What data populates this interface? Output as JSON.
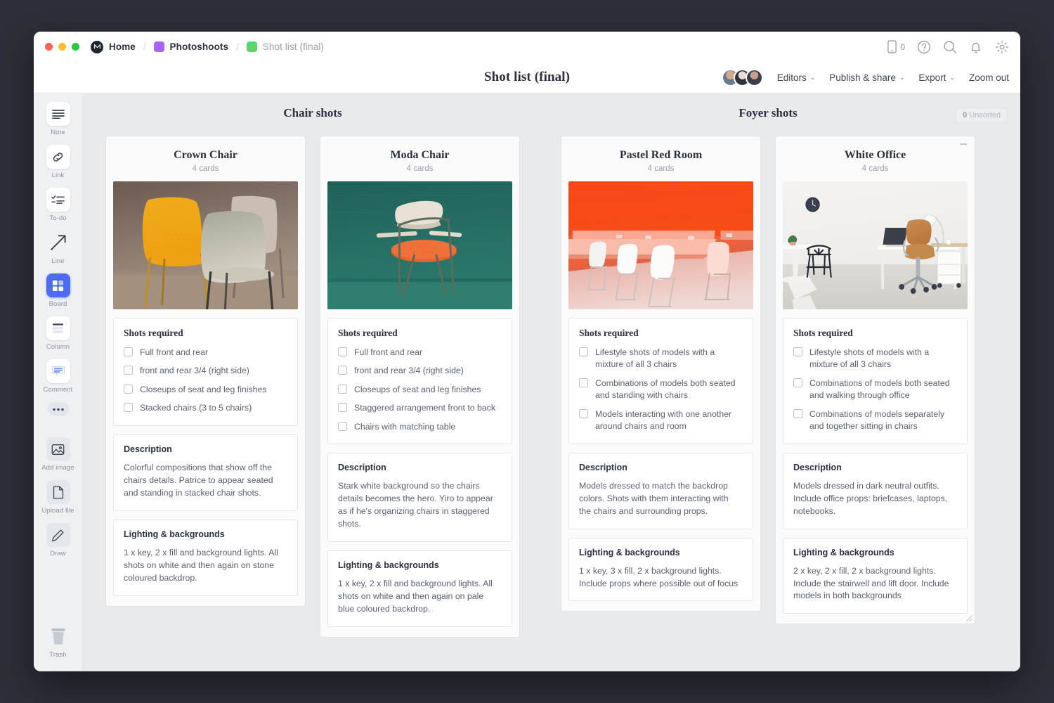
{
  "window": {
    "breadcrumb": [
      {
        "label": "Home",
        "icon": "milanote-logo-icon",
        "swatch": null,
        "muted": false
      },
      {
        "label": "Photoshoots",
        "icon": null,
        "swatch": "#a566f5",
        "muted": false
      },
      {
        "label": "Shot list (final)",
        "icon": null,
        "swatch": "#5ed36a",
        "muted": true
      }
    ],
    "separator": "/",
    "title_icons": [
      {
        "name": "mobile-icon",
        "badge": "0"
      },
      {
        "name": "help-icon",
        "badge": null
      },
      {
        "name": "search-icon",
        "badge": null
      },
      {
        "name": "notifications-icon",
        "badge": null
      },
      {
        "name": "settings-gear-icon",
        "badge": null
      }
    ]
  },
  "toolbar": {
    "doc_title": "Shot list (final)",
    "editors_label": "Editors",
    "publish_label": "Publish & share",
    "export_label": "Export",
    "zoom_out_label": "Zoom out",
    "caret": "⌄"
  },
  "sidebar": {
    "tools": [
      {
        "label": "Note",
        "icon": "note-icon"
      },
      {
        "label": "Link",
        "icon": "link-icon"
      },
      {
        "label": "To-do",
        "icon": "todo-icon"
      },
      {
        "label": "Line",
        "icon": "line-arrow-icon"
      },
      {
        "label": "Board",
        "icon": "board-icon"
      },
      {
        "label": "Column",
        "icon": "column-icon"
      },
      {
        "label": "Comment",
        "icon": "comment-icon"
      },
      {
        "label": "",
        "icon": "more-dots-icon"
      }
    ],
    "file_tools": [
      {
        "label": "Add image",
        "icon": "add-image-icon"
      },
      {
        "label": "Upload file",
        "icon": "upload-file-icon"
      },
      {
        "label": "Draw",
        "icon": "draw-pencil-icon"
      }
    ],
    "trash": {
      "label": "Trash",
      "icon": "trash-icon"
    },
    "active_tool": "Board"
  },
  "canvas": {
    "unsorted_count": "0",
    "unsorted_label": "Unsorted",
    "sections": [
      {
        "title": "Chair shots",
        "boards": [
          {
            "title": "Crown Chair",
            "card_count": "4 cards",
            "image": "yellow-and-beige-chairs-photo",
            "shots_heading": "Shots required",
            "shots": [
              "Full front and rear",
              "front and rear 3/4 (right side)",
              "Closeups of seat and leg finishes",
              "Stacked chairs (3 to 5 chairs)"
            ],
            "description_heading": "Description",
            "description": "Colorful compositions that show off the chairs details. Patrice to appear seated and standing in stacked chair shots.",
            "lighting_heading": "Lighting & backgrounds",
            "lighting": "1 x key, 2 x fill and background lights. All shots on white and then again on stone coloured backdrop."
          },
          {
            "title": "Moda Chair",
            "card_count": "4 cards",
            "image": "green-wall-chair-photo",
            "shots_heading": "Shots required",
            "shots": [
              "Full front and rear",
              "front and rear 3/4 (right side)",
              "Closeups of seat and leg finishes",
              "Staggered arrangement front to back",
              "Chairs with matching table"
            ],
            "description_heading": "Description",
            "description": "Stark white background so the chairs details becomes the hero. Yiro to appear as if he's organizing chairs in staggered shots.",
            "lighting_heading": "Lighting & backgrounds",
            "lighting": "1 x key, 2 x fill and background lights. All shots on white and then again on pale blue coloured backdrop."
          }
        ]
      },
      {
        "title": "Foyer shots",
        "boards": [
          {
            "title": "Pastel Red Room",
            "card_count": "4 cards",
            "image": "orange-room-white-chairs-photo",
            "shots_heading": "Shots required",
            "shots": [
              "Lifestyle shots of models with a mixture of all 3 chairs",
              "Combinations of models both seated and standing with chairs",
              "Models interacting with one another around chairs and room"
            ],
            "description_heading": "Description",
            "description": "Models dressed to match the backdrop colors. Shots with them interacting with the chairs and surrounding props.",
            "lighting_heading": "Lighting & backgrounds",
            "lighting": "1 x key, 3 x fill, 2 x background lights. Include props where possible out of focus"
          },
          {
            "title": "White Office",
            "card_count": "4 cards",
            "image": "white-office-desk-photo",
            "shots_heading": "Shots required",
            "shots": [
              "Lifestyle shots of models with a mixture of all 3 chairs",
              "Combinations of models both seated and walking through office",
              "Combinations of models separately and together sitting in chairs"
            ],
            "description_heading": "Description",
            "description": "Models dressed in dark neutral outfits. Include office props: briefcases, laptops, notebooks.",
            "lighting_heading": "Lighting & backgrounds",
            "lighting": "2 x key, 2 x fill, 2 x background lights. Include the stairwell and lift door. Include models in both backgrounds"
          }
        ]
      }
    ]
  }
}
